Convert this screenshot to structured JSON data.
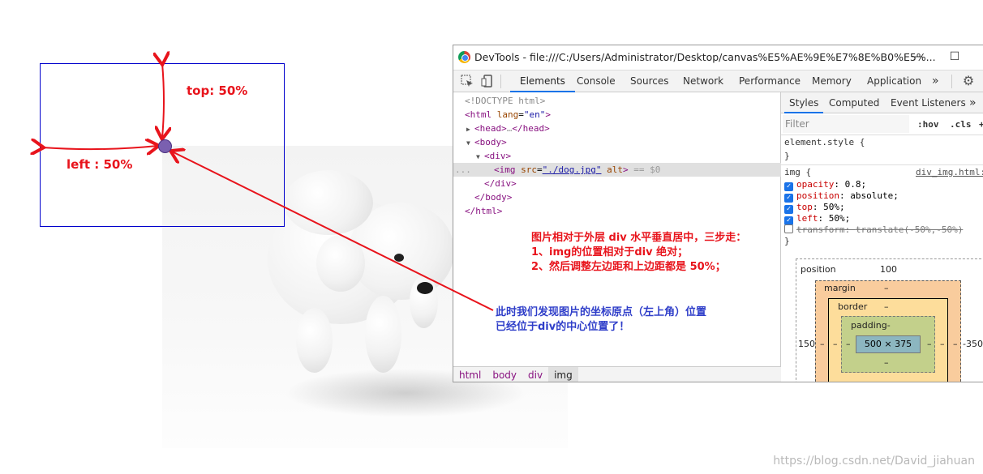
{
  "annotations": {
    "top_label": "top: 50%",
    "left_label": "left : 50%",
    "steps_title": "图片相对于外层 div 水平垂直居中，三步走：",
    "step1": "1、img的位置相对于div 绝对；",
    "step2": "2、然后调整左边距和上边距都是 50%；",
    "note_line1": "此时我们发现图片的坐标原点（左上角）位置",
    "note_line2": "已经位于div的中心位置了！"
  },
  "devtools": {
    "title": "DevTools - file:///C:/Users/Administrator/Desktop/canvas%E5%AE%9E%E7%8E%B0%E5%...",
    "window_buttons": {
      "minimize": "—",
      "maximize": "☐"
    },
    "tabs": [
      "Elements",
      "Console",
      "Sources",
      "Network",
      "Performance",
      "Memory",
      "Application"
    ],
    "more_tabs": "»",
    "active_tab": "Elements"
  },
  "elements": {
    "doctype": "<!DOCTYPE html>",
    "html_open_tag": "<html",
    "html_lang_attr": "lang",
    "html_lang_val": "\"en\"",
    "html_open_close": ">",
    "head_open": "<head>",
    "head_ellipsis": "…",
    "head_close": "</head>",
    "body_open": "<body>",
    "div_open": "<div>",
    "img_tag": "<img",
    "img_src_attr": "src",
    "img_src_val": "\"./dog.jpg\"",
    "img_alt_attr": "alt",
    "img_close": ">",
    "img_suffix": "== $0",
    "selected_prefix": "...",
    "div_close": "</div>",
    "body_close": "</body>",
    "html_close": "</html>"
  },
  "breadcrumbs": [
    "html",
    "body",
    "div",
    "img"
  ],
  "styles": {
    "tabs": [
      "Styles",
      "Computed",
      "Event Listeners"
    ],
    "more_tabs": "»",
    "filter_placeholder": "Filter",
    "hov": ":hov",
    "cls": ".cls",
    "plus": "+",
    "element_style": "element.style {",
    "close_brace": "}",
    "img_rule_selector": "img {",
    "img_rule_source": "div_img.html:",
    "declarations": [
      {
        "prop": "opacity",
        "value": "0.8;",
        "enabled": true
      },
      {
        "prop": "position",
        "value": "absolute;",
        "enabled": true
      },
      {
        "prop": "top",
        "value": "50%;",
        "enabled": true
      },
      {
        "prop": "left",
        "value": "50%;",
        "enabled": true
      },
      {
        "prop": "transform",
        "value": "translate(-50%,-50%)",
        "enabled": false
      }
    ]
  },
  "box_model": {
    "position_label": "position",
    "position_top": "100",
    "position_left": "150",
    "position_right": "-350",
    "margin_label": "margin",
    "border_label": "border",
    "padding_label": "padding-",
    "dash": "–",
    "content_size": "500 × 375"
  },
  "watermark": "https://blog.csdn.net/David_jiahuan"
}
